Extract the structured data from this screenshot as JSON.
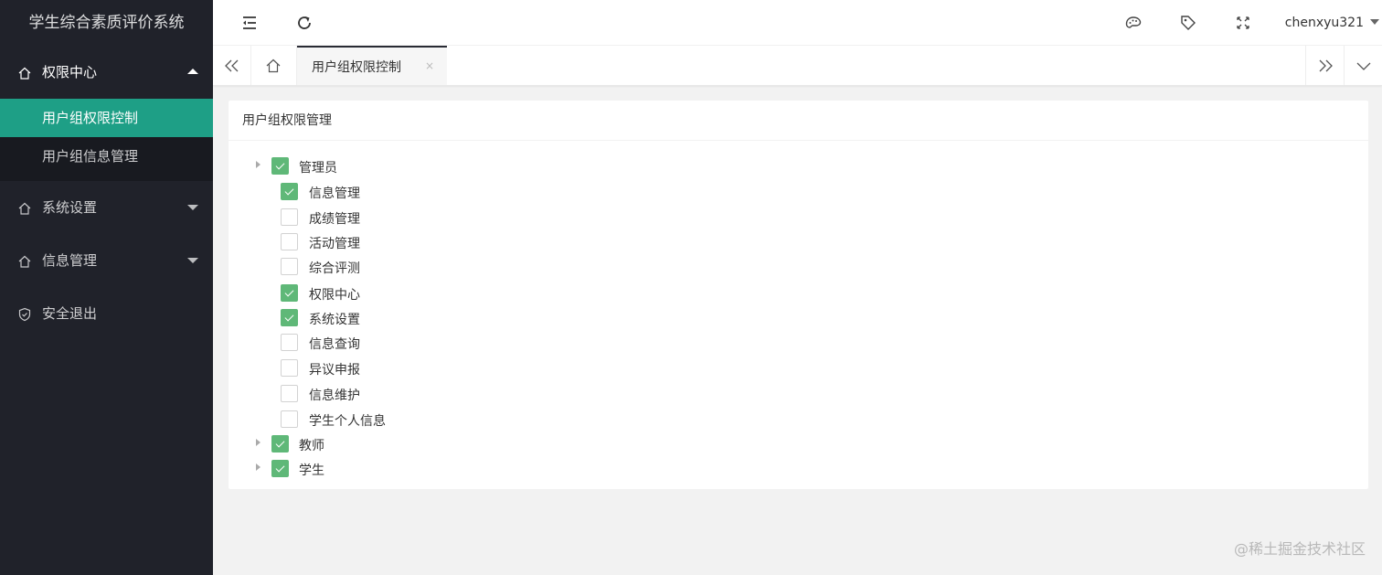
{
  "app_title": "学生综合素质评价系统",
  "sidebar": {
    "items": [
      {
        "label": "权限中心",
        "icon": "home-icon",
        "open": true,
        "children": [
          {
            "label": "用户组权限控制",
            "active": true
          },
          {
            "label": "用户组信息管理",
            "active": false
          }
        ]
      },
      {
        "label": "系统设置",
        "icon": "home-icon",
        "open": false
      },
      {
        "label": "信息管理",
        "icon": "home-icon",
        "open": false
      },
      {
        "label": "安全退出",
        "icon": "shield-icon",
        "open": false
      }
    ]
  },
  "header": {
    "icons": [
      "shrink-menu-icon",
      "refresh-icon",
      "theme-palette-icon",
      "tag-icon",
      "fullscreen-icon"
    ],
    "username": "chenxyu321"
  },
  "tabs": {
    "items": [
      {
        "label": "用户组权限控制",
        "close": "×"
      }
    ]
  },
  "card": {
    "title": "用户组权限管理",
    "tree": [
      {
        "label": "管理员",
        "checked": true,
        "expanded": true,
        "children": [
          {
            "label": "信息管理",
            "checked": true
          },
          {
            "label": "成绩管理",
            "checked": false
          },
          {
            "label": "活动管理",
            "checked": false
          },
          {
            "label": "综合评测",
            "checked": false
          },
          {
            "label": "权限中心",
            "checked": true
          },
          {
            "label": "系统设置",
            "checked": true
          },
          {
            "label": "信息查询",
            "checked": false
          },
          {
            "label": "异议申报",
            "checked": false
          },
          {
            "label": "信息维护",
            "checked": false
          },
          {
            "label": "学生个人信息",
            "checked": false
          }
        ]
      },
      {
        "label": "教师",
        "checked": true,
        "expanded": false
      },
      {
        "label": "学生",
        "checked": true,
        "expanded": false
      }
    ]
  },
  "watermark": "@稀土掘金技术社区",
  "colors": {
    "sidebar_bg": "#20222a",
    "active": "#1e9f86",
    "check": "#5fb878"
  }
}
